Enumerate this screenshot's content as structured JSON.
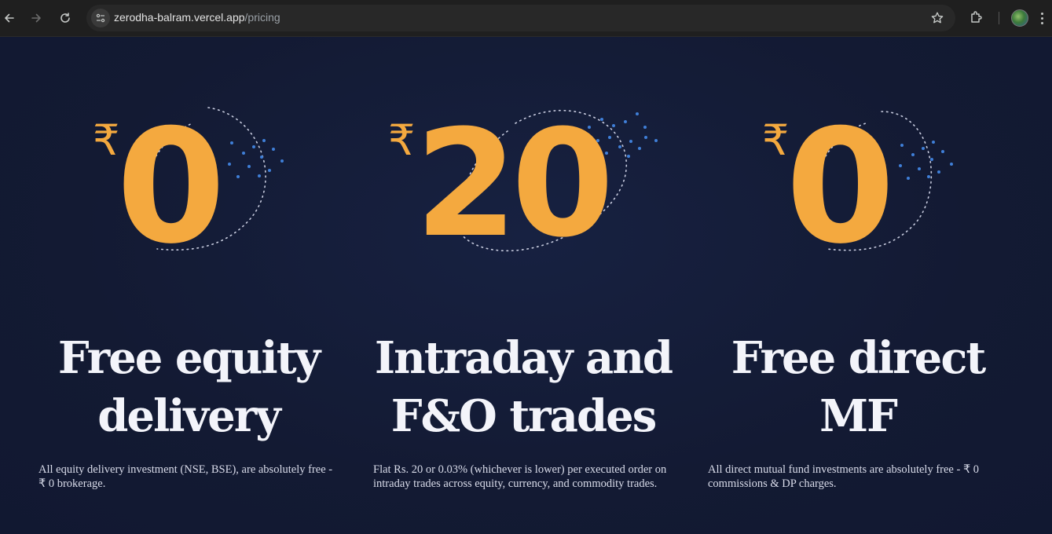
{
  "browser": {
    "url_host": "zerodha-balram.vercel.app",
    "url_path": "/pricing",
    "icons": [
      "back-icon",
      "forward-icon",
      "reload-icon",
      "site-info-icon",
      "bookmark-star-icon",
      "extensions-icon",
      "profile-avatar",
      "more-menu-icon"
    ]
  },
  "colors": {
    "background": "#131a33",
    "price_orange": "#f4a93f",
    "dots_blue": "#3f7fd8",
    "title_text": "#f3f4fa",
    "body_text": "#d9dcea"
  },
  "cards": [
    {
      "currency": "₹",
      "amount": "0",
      "title_line1": "Free equity",
      "title_line2": "delivery",
      "description": "All equity delivery investment (NSE, BSE), are absolutely free - ₹ 0 brokerage."
    },
    {
      "currency": "₹",
      "amount": "20",
      "title_line1": "Intraday and",
      "title_line2": "F&O trades",
      "description": "Flat Rs. 20 or 0.03% (whichever is lower) per executed order on intraday trades across equity, currency, and commodity trades."
    },
    {
      "currency": "₹",
      "amount": "0",
      "title_line1": "Free direct",
      "title_line2": "MF",
      "description": "All direct mutual fund investments are absolutely free - ₹ 0 commissions & DP charges."
    }
  ]
}
